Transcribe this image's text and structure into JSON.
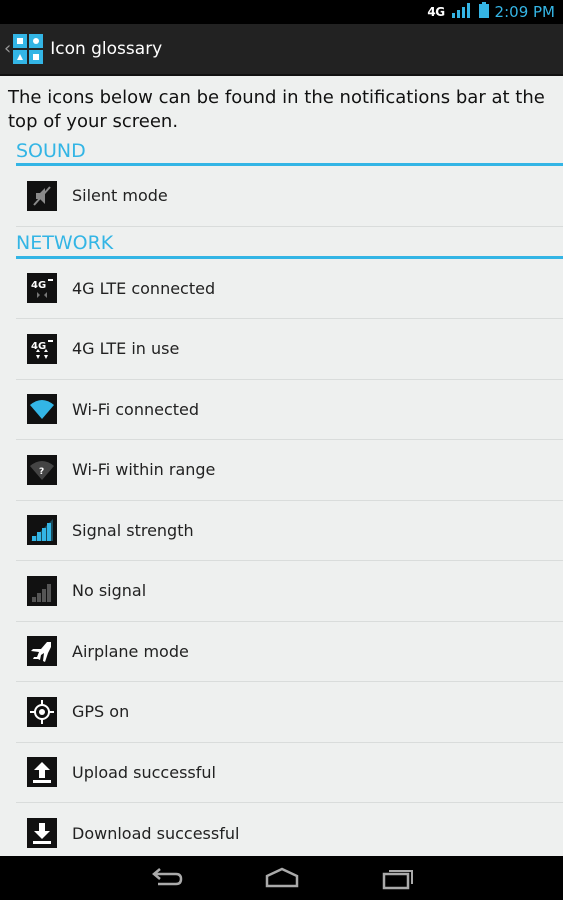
{
  "status_bar": {
    "network": "4G",
    "time": "2:09 PM"
  },
  "action_bar": {
    "title": "Icon glossary"
  },
  "intro": "The icons below can be found in the notifications bar at the top of your screen.",
  "sections": [
    {
      "title": "SOUND",
      "items": [
        {
          "label": "Silent mode",
          "icon": "silent-mode-icon"
        }
      ]
    },
    {
      "title": "NETWORK",
      "items": [
        {
          "label": "4G LTE connected",
          "icon": "4g-lte-connected-icon"
        },
        {
          "label": "4G LTE in use",
          "icon": "4g-lte-in-use-icon"
        },
        {
          "label": "Wi-Fi connected",
          "icon": "wifi-connected-icon"
        },
        {
          "label": "Wi-Fi within range",
          "icon": "wifi-within-range-icon"
        },
        {
          "label": "Signal strength",
          "icon": "signal-strength-icon"
        },
        {
          "label": "No signal",
          "icon": "no-signal-icon"
        },
        {
          "label": "Airplane mode",
          "icon": "airplane-icon"
        },
        {
          "label": "GPS on",
          "icon": "gps-icon"
        },
        {
          "label": "Upload successful",
          "icon": "upload-icon"
        },
        {
          "label": "Download successful",
          "icon": "download-icon"
        }
      ]
    }
  ],
  "colors": {
    "accent": "#33b5e5",
    "background": "#eef0ef",
    "action_bar": "#222222"
  }
}
